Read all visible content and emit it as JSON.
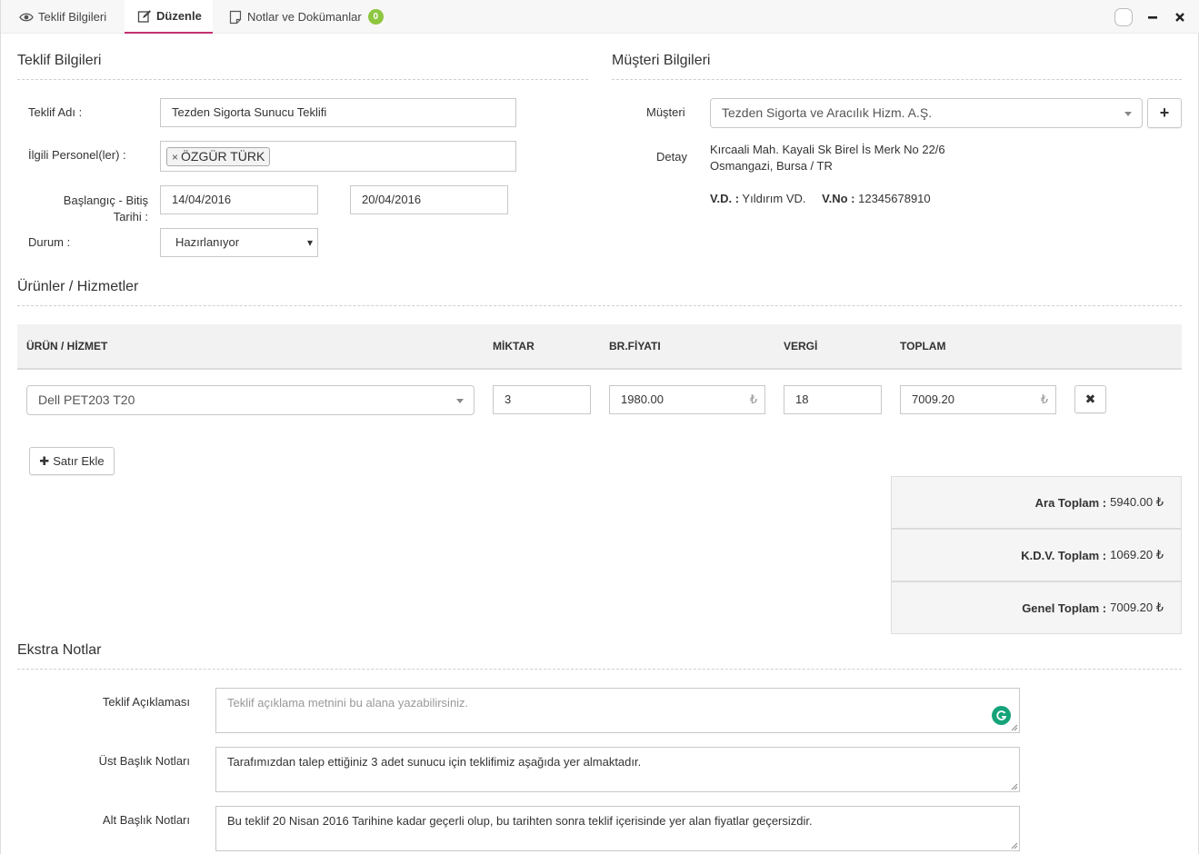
{
  "tabs": [
    {
      "label": "Teklif Bilgileri",
      "icon": "eye-icon"
    },
    {
      "label": "Düzenle",
      "icon": "edit-icon"
    },
    {
      "label": "Notlar ve Dokümanlar",
      "icon": "document-icon",
      "count": "0"
    }
  ],
  "offer_section": {
    "title": "Teklif Bilgileri",
    "name_label": "Teklif Adı :",
    "name_value": "Tezden Sigorta Sunucu Teklifi",
    "staff_label": "İlgili Personel(ler) :",
    "staff_tag": "ÖZGÜR TÜRK",
    "staff_tag_remove": "×",
    "dates_label_line1": "Başlangıç - Bitiş",
    "dates_label_line2": "Tarihi :",
    "start_date": "14/04/2016",
    "end_date": "20/04/2016",
    "status_label": "Durum :",
    "status_value": "Hazırlanıyor",
    "status_arrow": "▾"
  },
  "customer_section": {
    "title": "Müşteri Bilgileri",
    "customer_label": "Müşteri",
    "customer_value": "Tezden Sigorta ve Aracılık Hizm. A.Ş.",
    "add_symbol": "+",
    "detail_label": "Detay",
    "address_line1": "Kırcaali Mah. Kayali Sk Birel İs Merk No 22/6",
    "address_line2": "Osmangazi, Bursa / TR",
    "tax_office_label": "V.D. :",
    "tax_office_value": "Yıldırım VD.",
    "tax_no_label": "V.No :",
    "tax_no_value": "12345678910"
  },
  "products_section": {
    "title": "Ürünler / Hizmetler",
    "columns": [
      "ÜRÜN / HİZMET",
      "MİKTAR",
      "BR.FİYATI",
      "VERGİ",
      "TOPLAM"
    ],
    "rows": [
      {
        "product": "Dell PET203 T20",
        "quantity": "3",
        "unit_price": "1980.00",
        "tax": "18",
        "total": "7009.20",
        "remove_symbol": "✖"
      }
    ],
    "currency_symbol": "₺",
    "add_row_label": "Satır Ekle",
    "add_row_symbol": "✚"
  },
  "totals": {
    "subtotal_label": "Ara Toplam :",
    "subtotal_value": "5940.00 ₺",
    "vat_label": "K.D.V. Toplam :",
    "vat_value": "1069.20 ₺",
    "grand_label": "Genel Toplam :",
    "grand_value": "7009.20 ₺"
  },
  "notes_section": {
    "title": "Ekstra Notlar",
    "description_label": "Teklif Açıklaması",
    "description_placeholder": "Teklif açıklama metnini bu alana yazabilirsiniz.",
    "header_notes_label": "Üst Başlık Notları",
    "header_notes_value": "Tarafımızdan talep ettiğiniz 3 adet sunucu için teklifimiz aşağıda yer almaktadır.",
    "footer_notes_label": "Alt Başlık Notları",
    "footer_notes_value": "Bu teklif 20 Nisan 2016 Tarihine kadar geçerli olup, bu tarihten sonra teklif içerisinde yer alan fiyatlar geçersizdir."
  },
  "colors": {
    "accent": "#c4306f",
    "badge": "#8dc63f",
    "grammarly": "#15a37a"
  }
}
